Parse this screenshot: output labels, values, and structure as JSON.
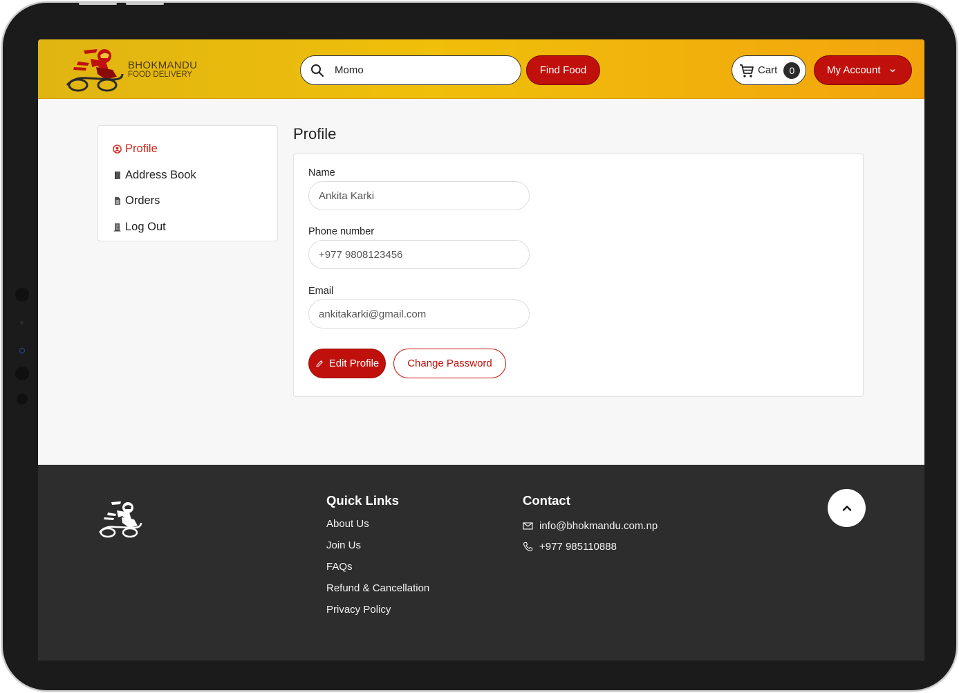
{
  "brand": {
    "name": "BHOKMANDU",
    "tagline": "FOOD DELIVERY",
    "logo_icon": "rider-logo-icon"
  },
  "colors": {
    "header_start": "#e0b512",
    "header_end": "#f2a40d",
    "accent_red": "#c0100b",
    "active_link": "#d0281f",
    "footer_bg": "#2d2d2d"
  },
  "header": {
    "search": {
      "value": "Momo",
      "icon": "search-icon"
    },
    "find_food_label": "Find Food",
    "cart": {
      "label": "Cart",
      "count": "0",
      "icon": "cart-icon"
    },
    "account_label": "My Account"
  },
  "sidebar": {
    "items": [
      {
        "label": "Profile",
        "icon": "user-circle-icon",
        "active": true
      },
      {
        "label": "Address Book",
        "icon": "book-icon",
        "active": false
      },
      {
        "label": "Orders",
        "icon": "document-icon",
        "active": false
      },
      {
        "label": "Log Out",
        "icon": "door-icon",
        "active": false
      }
    ]
  },
  "profile": {
    "title": "Profile",
    "fields": [
      {
        "label": "Name",
        "value": "Ankita Karki"
      },
      {
        "label": "Phone number",
        "value": "+977 9808123456"
      },
      {
        "label": "Email",
        "value": "ankitakarki@gmail.com"
      }
    ],
    "edit_label": "Edit Profile",
    "change_password_label": "Change Password"
  },
  "footer": {
    "quick_links_heading": "Quick Links",
    "links": [
      "About Us",
      "Join Us",
      "FAQs",
      "Refund & Cancellation",
      "Privacy Policy"
    ],
    "contact_heading": "Contact",
    "email": "info@bhokmandu.com.np",
    "phone": "+977 985110888"
  }
}
